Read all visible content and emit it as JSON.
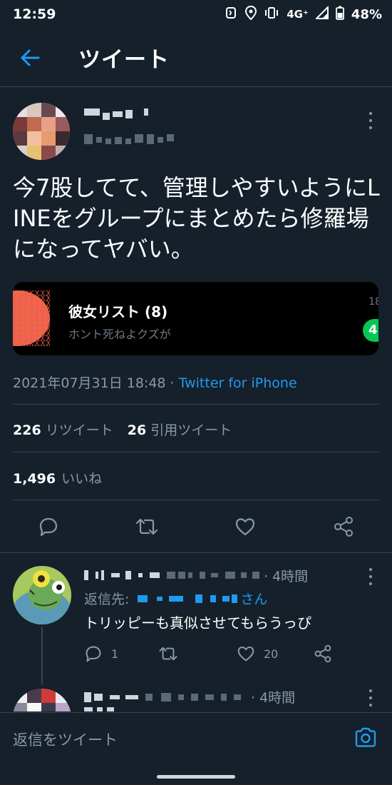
{
  "status_bar": {
    "time": "12:59",
    "network": "4G⁺",
    "battery": "48%"
  },
  "app_bar": {
    "title": "ツイート",
    "icons": [
      "back-arrow-icon"
    ]
  },
  "tweet": {
    "text": "今7股してて、管理しやすいようにLINEをグループにまとめたら修羅場になってヤバい。",
    "embedded_card": {
      "group_name": "彼女リスト (8)",
      "message_preview": "ホント死ねよクズが",
      "time_fragment": "18",
      "unread_badge": "4"
    },
    "timestamp": "2021年07月31日 18:48",
    "separator": " · ",
    "client": "Twitter for iPhone",
    "retweets_count": "226",
    "retweets_label": "リツイート",
    "quotes_count": "26",
    "quotes_label": "引用ツイート",
    "likes_count": "1,496",
    "likes_label": "いいね"
  },
  "replies": [
    {
      "time": "· 4時間",
      "reply_to_prefix": "返信先:",
      "reply_to_suffix": "さん",
      "text": "トリッピーも真似させてもらうっぴ",
      "reply_count": "1",
      "retweet_count": "",
      "like_count": "20"
    },
    {
      "time": "· 4時間"
    }
  ],
  "compose": {
    "placeholder": "返信をツイート"
  },
  "colors": {
    "background": "#15202b",
    "accent": "#1d9bf0",
    "secondary_text": "#8899a6",
    "divider": "#38444d",
    "line_green": "#06c755",
    "card_avatar": "#f26650"
  }
}
